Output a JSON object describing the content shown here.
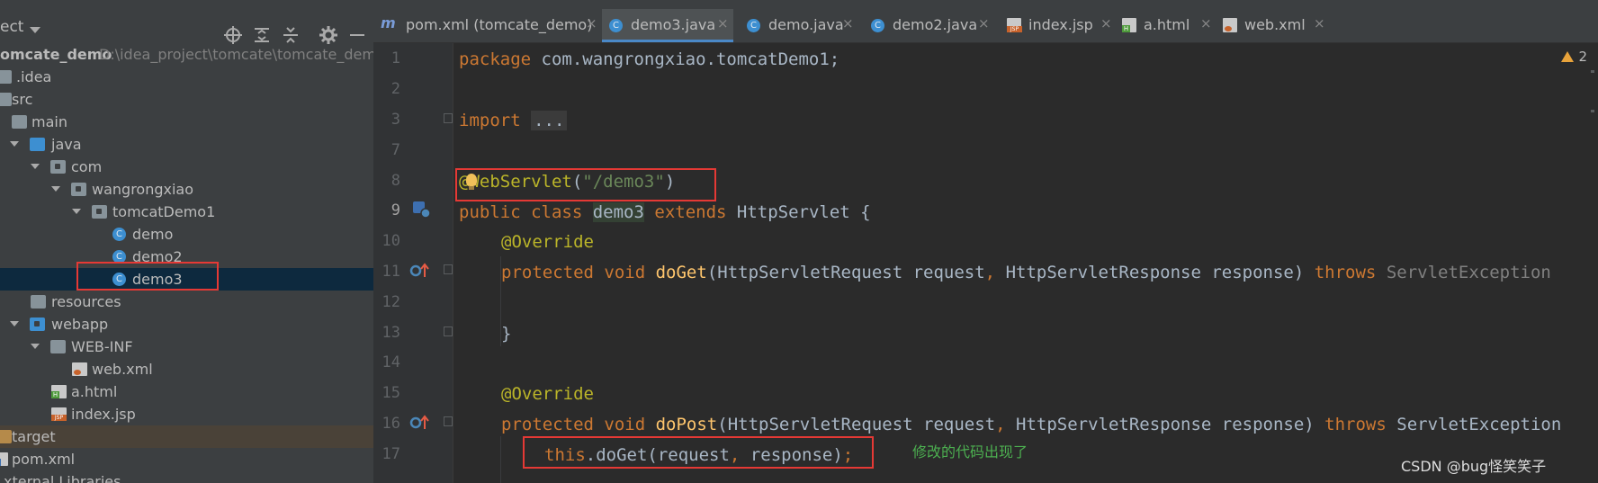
{
  "project": {
    "title": "ect",
    "items": [
      {
        "label": "omcate_demo",
        "detail": "D:\\idea_project\\tomcate\\tomcate_demo",
        "icon": "module-folder-icon"
      },
      {
        "label": ".idea",
        "icon": "folder-icon"
      },
      {
        "label": "src",
        "icon": "folder-icon"
      },
      {
        "label": "main",
        "icon": "folder-icon"
      },
      {
        "label": "java",
        "icon": "source-folder-icon"
      },
      {
        "label": "com",
        "icon": "package-icon"
      },
      {
        "label": "wangrongxiao",
        "icon": "package-icon"
      },
      {
        "label": "tomcatDemo1",
        "icon": "package-icon"
      },
      {
        "label": "demo",
        "icon": "java-class-icon"
      },
      {
        "label": "demo2",
        "icon": "java-class-icon"
      },
      {
        "label": "demo3",
        "icon": "java-class-icon"
      },
      {
        "label": "resources",
        "icon": "resources-folder-icon"
      },
      {
        "label": "webapp",
        "icon": "web-folder-icon"
      },
      {
        "label": "WEB-INF",
        "icon": "folder-icon"
      },
      {
        "label": "web.xml",
        "icon": "xml-file-icon"
      },
      {
        "label": "a.html",
        "icon": "html-file-icon"
      },
      {
        "label": "index.jsp",
        "icon": "jsp-file-icon"
      },
      {
        "label": "target",
        "icon": "excluded-folder-icon"
      },
      {
        "label": "pom.xml",
        "icon": "maven-file-icon"
      },
      {
        "label": "xternal Libraries",
        "icon": "library-icon"
      }
    ],
    "class_letter": "C"
  },
  "tabs": [
    {
      "label": "pom.xml (tomcate_demo)",
      "icon": "m"
    },
    {
      "label": "demo3.java",
      "icon": "C"
    },
    {
      "label": "demo.java",
      "icon": "C"
    },
    {
      "label": "demo2.java",
      "icon": "C"
    },
    {
      "label": "index.jsp",
      "icon": "JSP"
    },
    {
      "label": "a.html",
      "icon": "H"
    },
    {
      "label": "web.xml",
      "icon": "xml"
    }
  ],
  "tab_close": "×",
  "editor": {
    "warnings": "2",
    "line_numbers": [
      "1",
      "2",
      "3",
      "7",
      "8",
      "9",
      "10",
      "11",
      "12",
      "13",
      "14",
      "15",
      "16",
      "17"
    ],
    "tokens": {
      "package_kw": "package",
      "package_name": " com.wangrongxiao.tomcatDemo1;",
      "import_kw": "import",
      "import_folded": "...",
      "at": "@",
      "webservlet": "WebServlet",
      "paren_open": "(",
      "route": "\"/demo3\"",
      "paren_close": ")",
      "public_class": "public class",
      "class_name": "demo3",
      "extends": "extends",
      "httpservlet": " HttpServlet {",
      "override": "@Override",
      "protected_void": "protected void",
      "doget": "doGet",
      "params_open": "(HttpServletRequest request",
      "comma": ",",
      "params_rest": " HttpServletResponse response) ",
      "throws": "throws",
      "servlet_exc": " ServletException",
      "close_brace": "}",
      "dopost": "doPost",
      "this_kw": "this",
      "call_rest": ".doGet(request",
      "call_rest2": " response)",
      "semicolon": ";"
    },
    "annotation_note": "修改的代码出现了"
  },
  "watermark": "CSDN @bug怪笑笑子",
  "colors": {
    "keyword": "#cc7832",
    "annotation": "#bbb529",
    "string": "#6a8759",
    "method": "#ffc66d",
    "highlight_box": "#e53935",
    "note": "#4caf50"
  }
}
